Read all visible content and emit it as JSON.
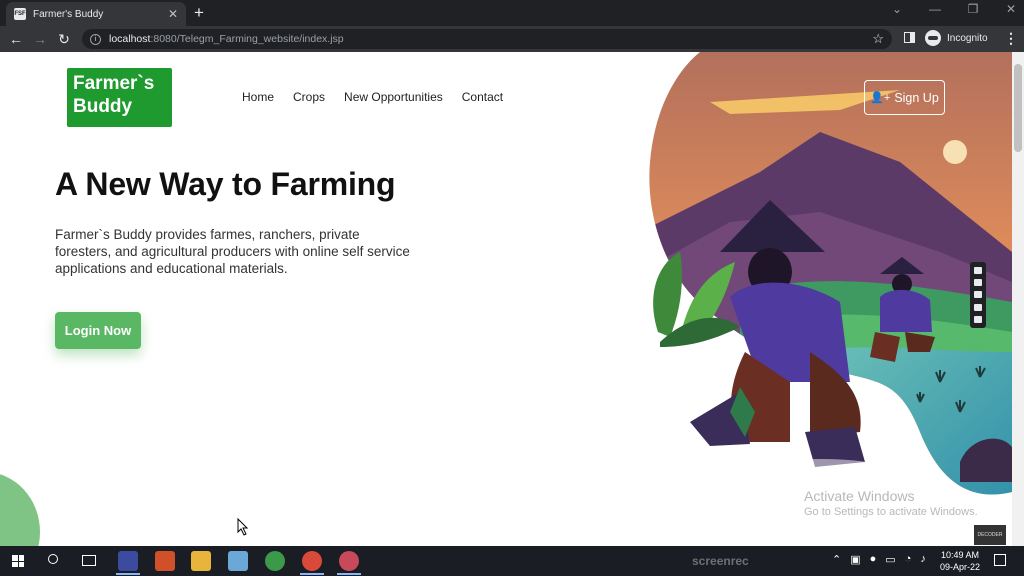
{
  "browser": {
    "tab_title": "Farmer's Buddy",
    "favicon_text": "FSF",
    "new_tab_label": "+",
    "close_label": "✕",
    "url_host": "localhost",
    "url_rest": ":8080/Telegm_Farming_website/index.jsp",
    "mode_label": "Incognito"
  },
  "site": {
    "logo_line1": "Farmer`s",
    "logo_line2": "Buddy",
    "nav": [
      "Home",
      "Crops",
      "New Opportunities",
      "Contact"
    ],
    "signup_label": "Sign Up",
    "hero_title": "A New Way to Farming",
    "hero_desc": "Farmer`s Buddy provides farmes, ranchers, private foresters, and agricultural producers with online self service applications and educational materials.",
    "login_label": "Login Now"
  },
  "os": {
    "activate_title": "Activate Windows",
    "activate_sub": "Go to Settings to activate Windows.",
    "decoder_label": "DECODER",
    "screenrec_label": "screenrec",
    "time": "10:49 AM",
    "date": "09-Apr-22"
  },
  "colors": {
    "logo_green": "#1f9a2e",
    "button_green": "#5ab865",
    "sky_top": "#b77a5e",
    "sky_bottom": "#f3a65a",
    "mountain": "#5a3d6a",
    "farmer_shirt": "#4f3aa0"
  }
}
